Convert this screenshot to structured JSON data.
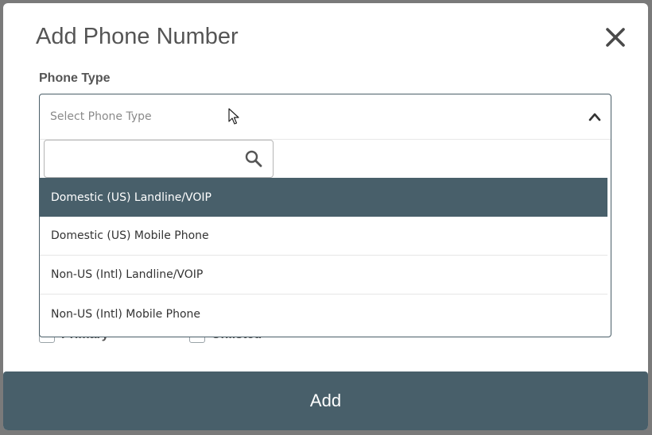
{
  "dialog": {
    "title": "Add Phone Number",
    "close_icon": "close-icon"
  },
  "phone_type": {
    "label": "Phone Type",
    "placeholder": "Select Phone Type",
    "search_value": "",
    "chevron_icon": "chevron-up-icon",
    "search_icon": "search-icon",
    "options": [
      "Domestic (US) Landline/VOIP",
      "Domestic (US) Mobile Phone",
      "Non-US (Intl) Landline/VOIP",
      "Non-US (Intl) Mobile Phone"
    ],
    "highlighted_index": 0
  },
  "background_checkboxes": [
    {
      "label": "Primary"
    },
    {
      "label": "Unlisted"
    }
  ],
  "footer": {
    "add_label": "Add"
  },
  "colors": {
    "accent": "#485f6a",
    "title_text": "#555555",
    "overlay": "#7a7a7a"
  }
}
